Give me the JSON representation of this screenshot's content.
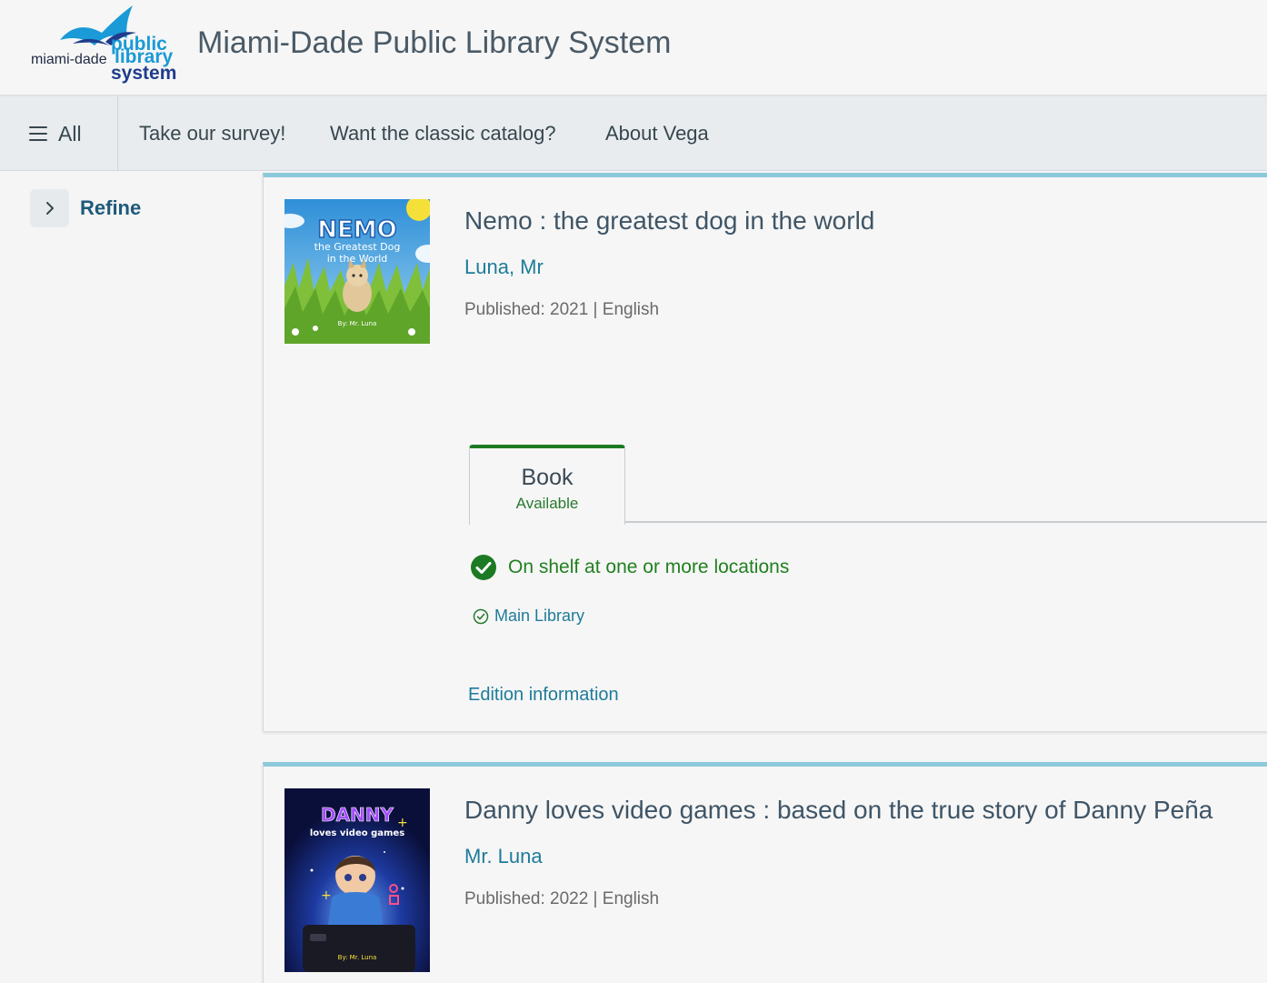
{
  "header": {
    "logo": {
      "line1": "public",
      "line2": "miami-dade",
      "line3": "library",
      "line4": "system"
    },
    "site_title": "Miami-Dade Public Library System"
  },
  "nav": {
    "all_label": "All",
    "links": [
      "Take our survey!",
      "Want the classic catalog?",
      "About Vega"
    ]
  },
  "sidebar": {
    "refine_label": "Refine"
  },
  "results": [
    {
      "title": "Nemo : the greatest dog in the world",
      "author": "Luna, Mr",
      "published": "Published: 2021 | English",
      "cover": {
        "title_big": "NEMO",
        "line1": "the Greatest Dog",
        "line2": "in the World",
        "byline": "By: Mr. Luna"
      },
      "format": {
        "type": "Book",
        "status": "Available"
      },
      "availability": "On shelf at one or more locations",
      "location": "Main Library",
      "edition_link": "Edition information"
    },
    {
      "title": "Danny loves video games : based on the true story of Danny Peña",
      "author": "Mr. Luna",
      "published": "Published: 2022 | English",
      "cover": {
        "title_big": "DANNY",
        "line1": "loves video games",
        "byline": "By: Mr. Luna"
      }
    }
  ],
  "colors": {
    "accent_teal": "#1e7b9a",
    "card_top_border": "#8ccadb",
    "available_green": "#20801f"
  }
}
